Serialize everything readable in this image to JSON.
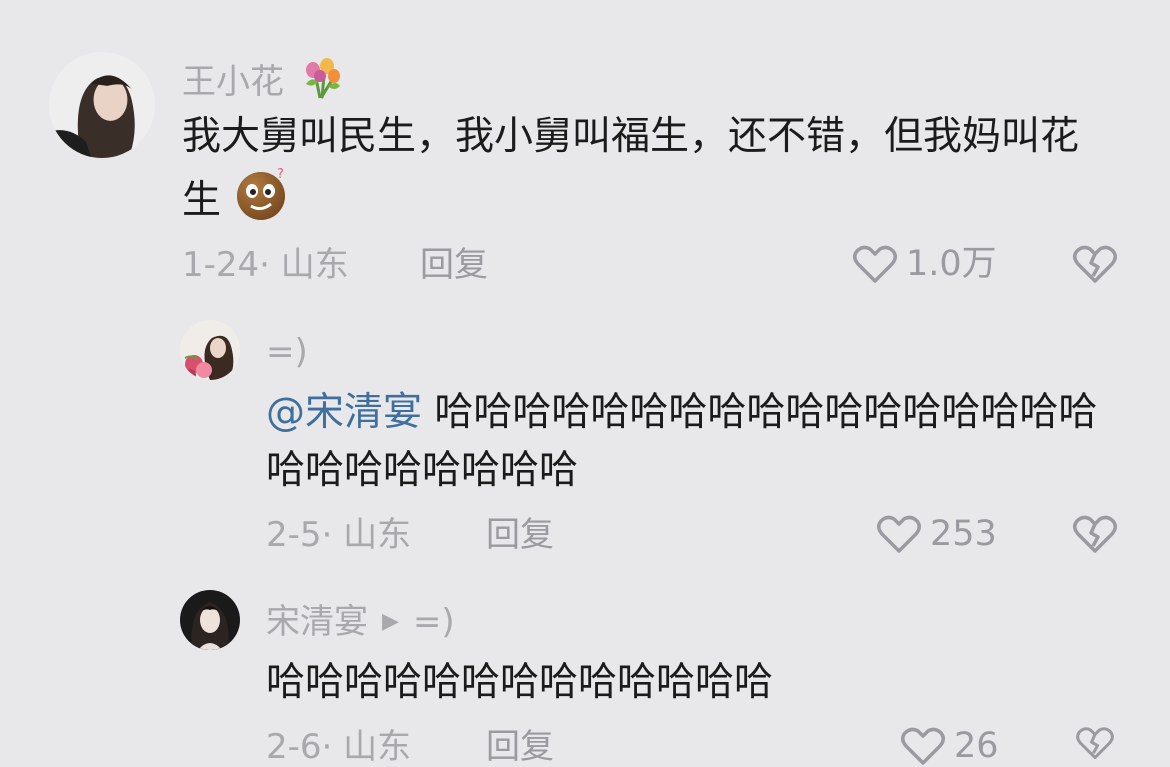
{
  "comments": [
    {
      "username": "王小花",
      "body": "我大舅叫民生，我小舅叫福生，还不错，但我妈叫花生",
      "date_location": "1-24· 山东",
      "reply_label": "回复",
      "likes": "1.0万"
    },
    {
      "username": "=)",
      "mention": "@宋清宴",
      "body": "哈哈哈哈哈哈哈哈哈哈哈哈哈哈哈哈哈哈哈哈哈哈哈哈哈",
      "date_location": "2-5· 山东",
      "reply_label": "回复",
      "likes": "253"
    },
    {
      "username": "宋清宴",
      "reply_to": "=)",
      "body": "哈哈哈哈哈哈哈哈哈哈哈哈哈",
      "date_location": "2-6· 山东",
      "reply_label": "回复",
      "likes": "26"
    }
  ],
  "icons": {
    "badge": "flower-bouquet-icon",
    "emoji": "confused-face-icon",
    "like": "heart-outline-icon",
    "dislike": "broken-heart-icon",
    "reply_arrow": "play-triangle-icon"
  },
  "colors": {
    "background": "#e8e8ea",
    "text": "#1b1b1b",
    "muted": "#a8a8ad",
    "mention": "#3f6f9e"
  }
}
